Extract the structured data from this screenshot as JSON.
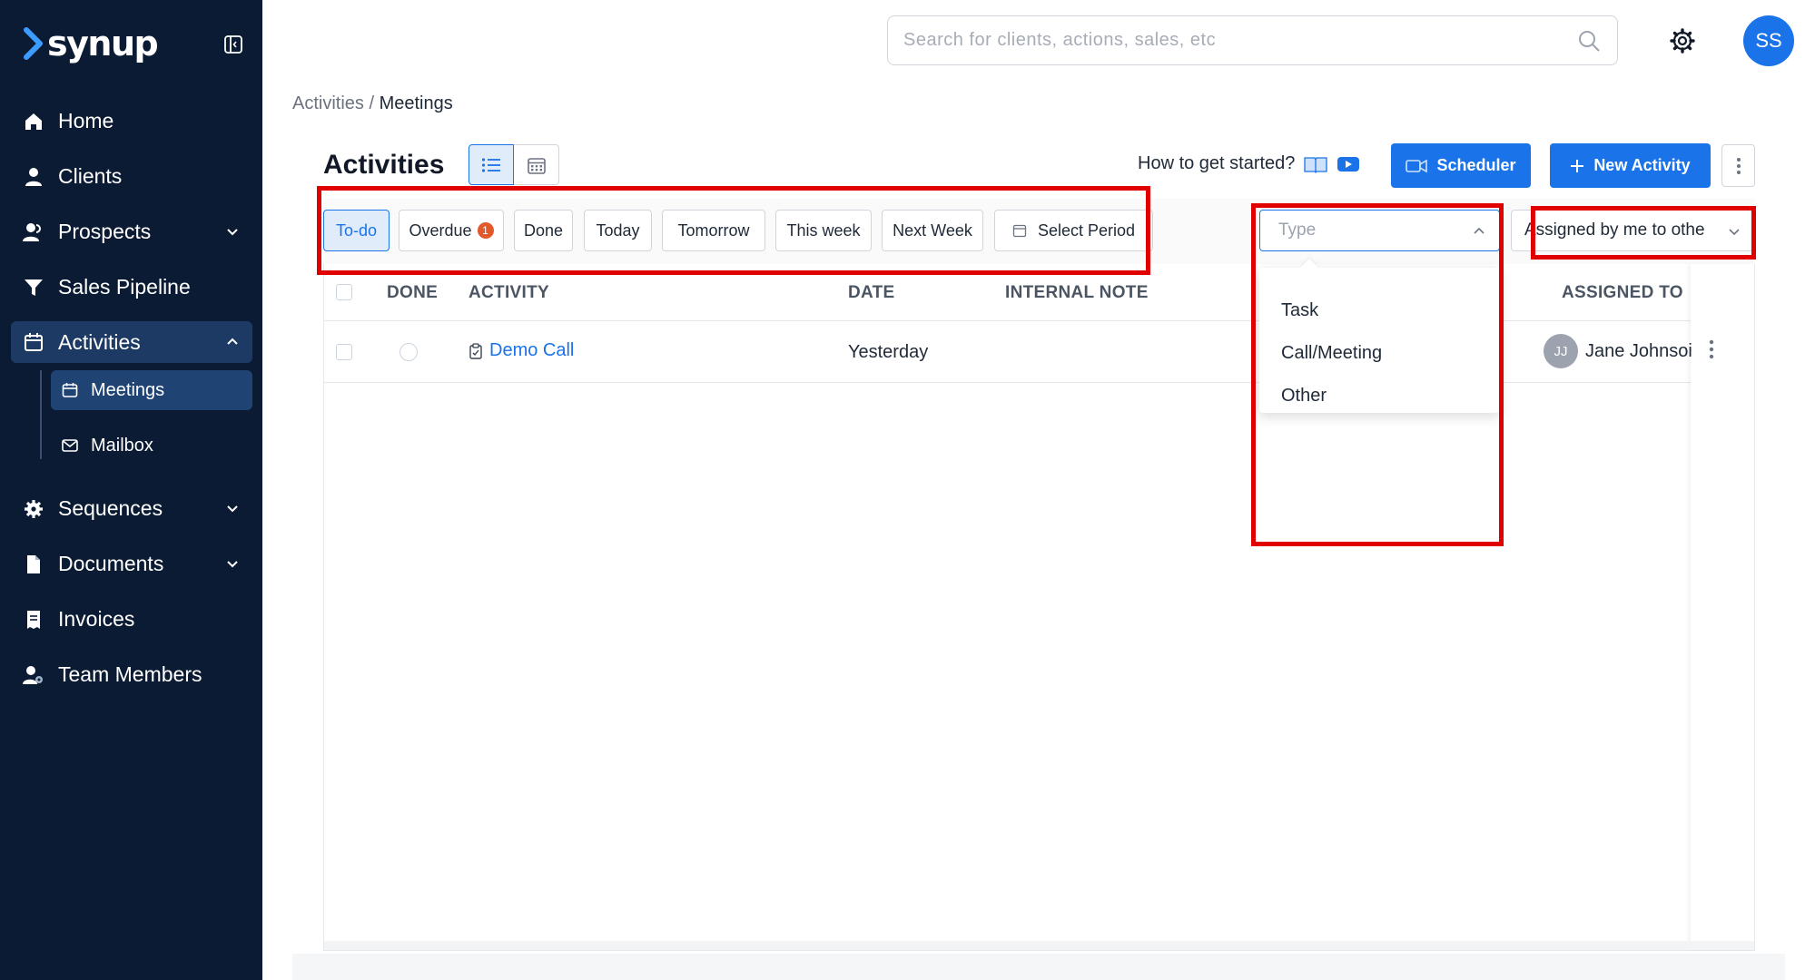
{
  "brand": {
    "name": "synup"
  },
  "sidebar": {
    "items": [
      {
        "label": "Home",
        "icon": "home-icon"
      },
      {
        "label": "Clients",
        "icon": "user-icon"
      },
      {
        "label": "Prospects",
        "icon": "users-icon"
      },
      {
        "label": "Sales Pipeline",
        "icon": "funnel-icon"
      },
      {
        "label": "Activities",
        "icon": "calendar-icon"
      },
      {
        "label": "Sequences",
        "icon": "gear-icon"
      },
      {
        "label": "Documents",
        "icon": "document-icon"
      },
      {
        "label": "Invoices",
        "icon": "invoice-icon"
      },
      {
        "label": "Team Members",
        "icon": "team-icon"
      }
    ],
    "subitems": [
      {
        "label": "Meetings",
        "icon": "calendar-icon"
      },
      {
        "label": "Mailbox",
        "icon": "mail-icon"
      }
    ]
  },
  "topbar": {
    "search_placeholder": "Search for clients, actions, sales, etc",
    "avatar_initials": "SS"
  },
  "breadcrumb": {
    "parent": "Activities",
    "separator": "/",
    "current": "Meetings"
  },
  "page": {
    "title": "Activities",
    "how_to": "How to get started?",
    "scheduler_label": "Scheduler",
    "new_activity_label": "New Activity"
  },
  "filters": {
    "chips": [
      "To-do",
      "Overdue",
      "Done",
      "Today",
      "Tomorrow",
      "This week",
      "Next Week",
      "Select Period"
    ],
    "selected": "To-do",
    "overdue_count": "1",
    "type_placeholder": "Type",
    "assigned_value": "Assigned by me to othe"
  },
  "type_dropdown": {
    "options": [
      "Task",
      "Call/Meeting",
      "Other"
    ]
  },
  "table": {
    "headers": {
      "done": "DONE",
      "activity": "ACTIVITY",
      "date": "DATE",
      "internal_note": "INTERNAL NOTE",
      "assigned_to": "ASSIGNED TO"
    },
    "rows": [
      {
        "activity": "Demo Call",
        "date": "Yesterday",
        "internal_note": "",
        "assignee_initials": "JJ",
        "assignee_name": "Jane Johnsoi"
      }
    ]
  },
  "colors": {
    "sidebar_bg": "#0b1b33",
    "accent": "#1a73e8",
    "annotation": "#e00000",
    "badge": "#e05a2b"
  }
}
